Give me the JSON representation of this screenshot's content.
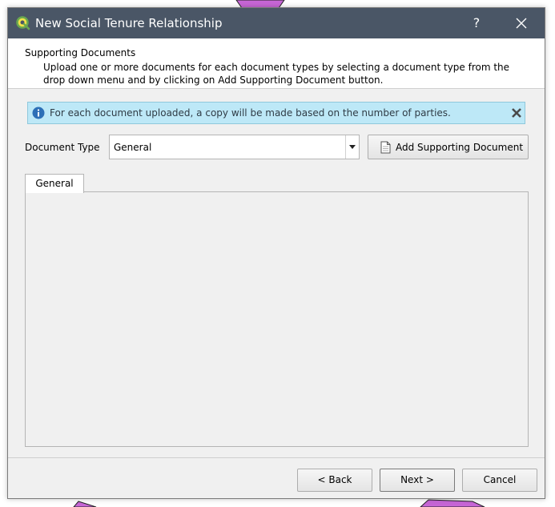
{
  "colors": {
    "titlebar": "#4a5666",
    "info_background": "#bde8f7",
    "dialog_background": "#f0f0f0",
    "map_feature": "#c766d6"
  },
  "window": {
    "title": "New Social Tenure Relationship",
    "icon": "qgis-icon",
    "help_label": "?",
    "close_icon": "close-icon"
  },
  "header": {
    "title": "Supporting Documents",
    "description": "Upload one or more documents for each document types by selecting a document type from the drop down menu and by clicking on Add Supporting Document button."
  },
  "info_bar": {
    "icon": "info-icon",
    "message": "For each document uploaded, a copy will be made based on the number of parties.",
    "close_icon": "close-icon"
  },
  "document_type": {
    "label": "Document Type",
    "selected": "General",
    "add_button_label": "Add Supporting Document",
    "add_button_icon": "document-icon"
  },
  "tabs": [
    {
      "label": "General",
      "active": true
    }
  ],
  "footer": {
    "back_label": "< Back",
    "next_label": "Next >",
    "cancel_label": "Cancel"
  }
}
